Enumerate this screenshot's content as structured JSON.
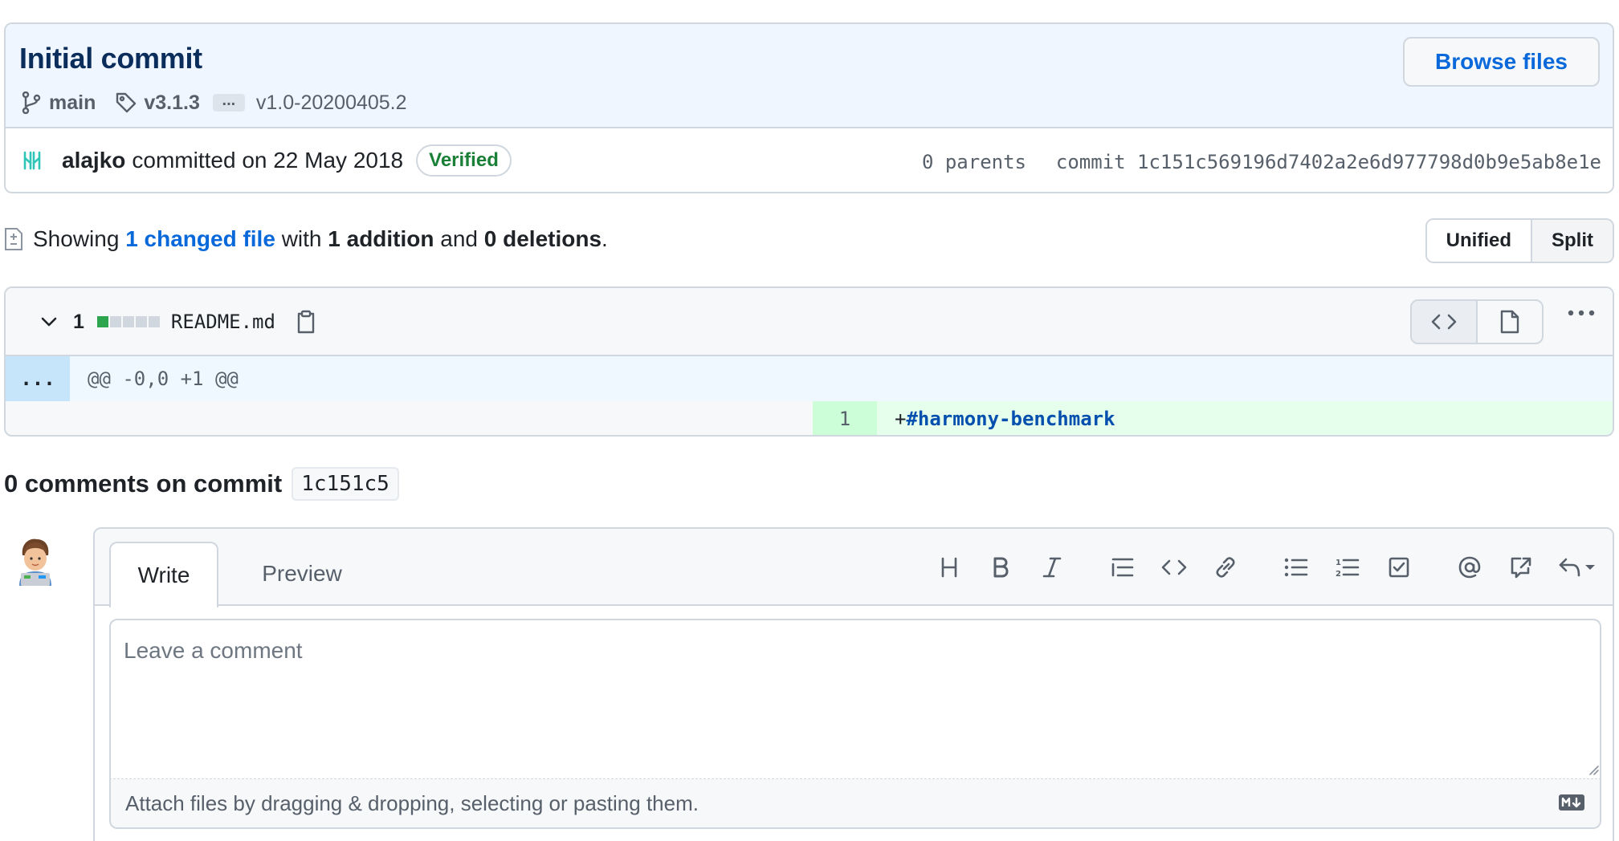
{
  "commit": {
    "title": "Initial commit",
    "browse_files_label": "Browse files",
    "branch": "main",
    "tag": "v3.1.3",
    "more_tags_label": "...",
    "tag2": "v1.0-20200405.2",
    "author": "alajko",
    "committed_text": "committed on 22 May 2018",
    "verified_label": "Verified",
    "parents_text": "0 parents",
    "commit_label": "commit",
    "sha": "1c151c569196d7402a2e6d977798d0b9e5ab8e1e"
  },
  "summary": {
    "prefix": "Showing",
    "changed_files": "1 changed file",
    "with": "with",
    "additions": "1 addition",
    "and": "and",
    "deletions": "0 deletions",
    "suffix": ".",
    "view_unified": "Unified",
    "view_split": "Split"
  },
  "file": {
    "changes_count": "1",
    "diffstat": [
      "add",
      "neutral",
      "neutral",
      "neutral",
      "neutral"
    ],
    "name": "README.md",
    "hunk_expand": "...",
    "hunk_header": "@@ -0,0 +1 @@",
    "lines": [
      {
        "new_num": "1",
        "prefix": "+",
        "markup": "#",
        "text": "harmony-benchmark"
      }
    ]
  },
  "comments": {
    "title": "0 comments on commit",
    "short_sha": "1c151c5",
    "tab_write": "Write",
    "tab_preview": "Preview",
    "placeholder": "Leave a comment",
    "attach_text": "Attach files by dragging & dropping, selecting or pasting them."
  },
  "colors": {
    "link": "#0969da",
    "verified": "#1a7f37",
    "addition": "#2da44e",
    "neutral": "#d0d7de"
  }
}
